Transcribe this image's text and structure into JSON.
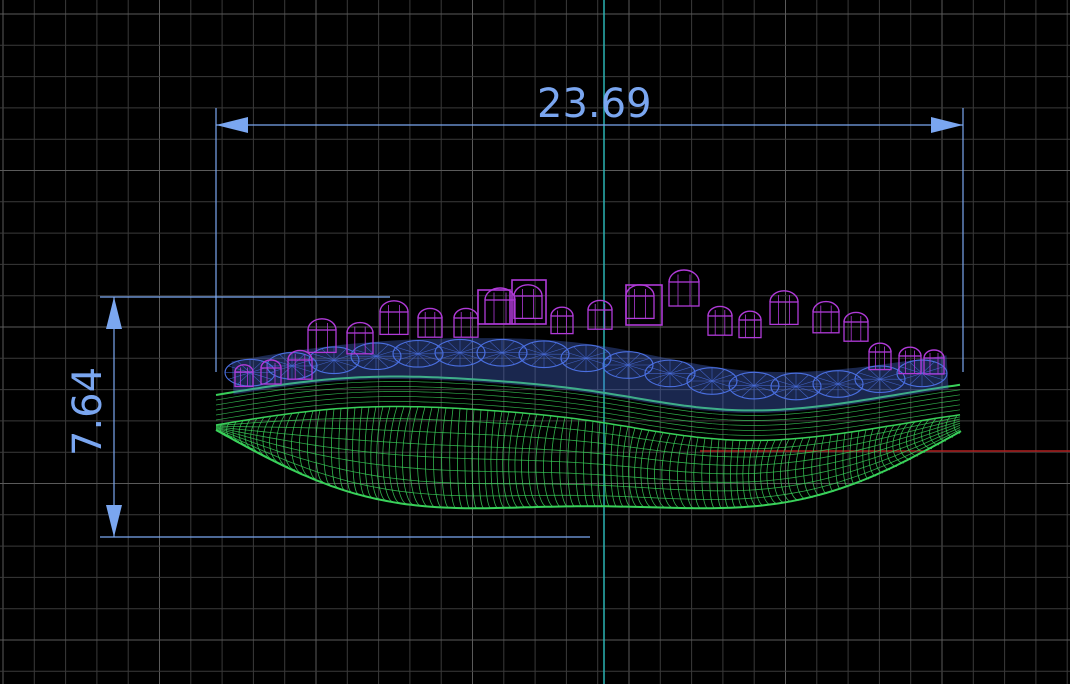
{
  "viewport": {
    "background": "#000000",
    "grid_color": "#3a3a3a",
    "grid_major_color": "#5a5a5a",
    "y_axis_color": "#2bb3b3",
    "x_axis_color": "#b02020"
  },
  "dimensions": {
    "width": {
      "value": "23.69",
      "color": "#7aa6f0"
    },
    "height": {
      "value": "7.64",
      "color": "#7aa6f0"
    }
  },
  "model": {
    "layers": [
      {
        "name": "shank",
        "color": "#39d15a",
        "icon": "wireframe-mesh"
      },
      {
        "name": "settings",
        "color": "#4a6fe0",
        "icon": "wireframe-mesh"
      },
      {
        "name": "stones",
        "color": "#b03ad8",
        "icon": "wireframe-mesh"
      }
    ]
  }
}
